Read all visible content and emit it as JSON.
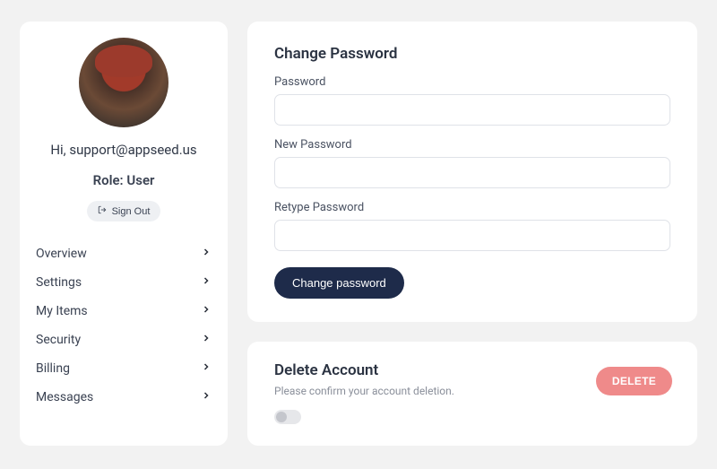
{
  "sidebar": {
    "greeting_prefix": "Hi, ",
    "user_email": "support@appseed.us",
    "role_label": "Role: ",
    "role_value": "User",
    "signout_label": "Sign Out",
    "nav_items": [
      {
        "label": "Overview"
      },
      {
        "label": "Settings"
      },
      {
        "label": "My Items"
      },
      {
        "label": "Security"
      },
      {
        "label": "Billing"
      },
      {
        "label": "Messages"
      }
    ]
  },
  "change_password": {
    "title": "Change Password",
    "password_label": "Password",
    "new_password_label": "New Password",
    "retype_password_label": "Retype Password",
    "submit_label": "Change password"
  },
  "delete_account": {
    "title": "Delete Account",
    "subtitle": "Please confirm your account deletion.",
    "button_label": "DELETE",
    "toggle_on": false
  },
  "colors": {
    "accent_dark": "#1e2b4a",
    "danger": "#ef8a8a"
  }
}
